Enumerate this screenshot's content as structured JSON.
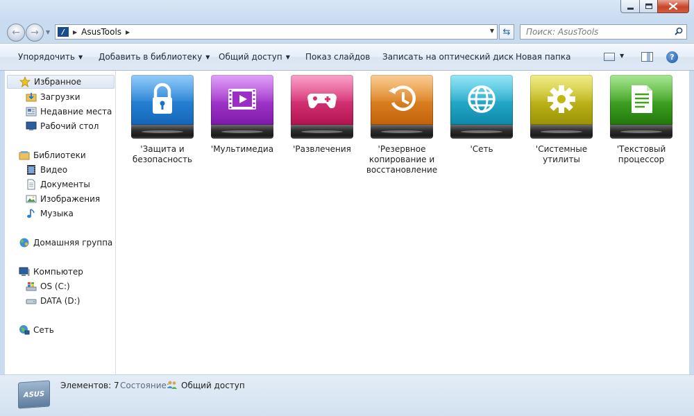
{
  "window": {
    "title_controls": [
      "minimize",
      "maximize",
      "close"
    ]
  },
  "address": {
    "path": "AsusTools",
    "search_placeholder": "Поиск: AsusTools"
  },
  "toolbar": {
    "organize": "Упорядочить",
    "add_library": "Добавить в библиотеку",
    "share": "Общий доступ",
    "slideshow": "Показ слайдов",
    "burn": "Записать на оптический диск",
    "new_folder": "Новая папка"
  },
  "navpane": {
    "favorites": "Избранное",
    "downloads": "Загрузки",
    "recent": "Недавние места",
    "desktop": "Рабочий стол",
    "libraries": "Библиотеки",
    "video": "Видео",
    "documents": "Документы",
    "images": "Изображения",
    "music": "Музыка",
    "homegroup": "Домашняя группа",
    "computer": "Компьютер",
    "drive_c": "OS (C:)",
    "drive_d": "DATA (D:)",
    "network": "Сеть"
  },
  "files": [
    {
      "label": "'Защита и безопасность",
      "icon": "lock-icon",
      "color": "#1f7fd1"
    },
    {
      "label": "'Мультимедиа",
      "icon": "film-icon",
      "color": "#9b2ec7"
    },
    {
      "label": "'Развлечения",
      "icon": "gamepad-icon",
      "color": "#e0286f"
    },
    {
      "label": "'Резервное копирование и восстановление",
      "icon": "history-icon",
      "color": "#e07b12"
    },
    {
      "label": "'Сеть",
      "icon": "globe-icon",
      "color": "#1aa9c9"
    },
    {
      "label": "'Системные утилиты",
      "icon": "gear-icon",
      "color": "#c2b80e"
    },
    {
      "label": "'Текстовый процессор",
      "icon": "document-icon",
      "color": "#3aa318"
    }
  ],
  "status": {
    "count": "Элементов: 7",
    "state_label": "Состояние:",
    "state_value": "Общий доступ",
    "logo_text": "ASUS"
  }
}
